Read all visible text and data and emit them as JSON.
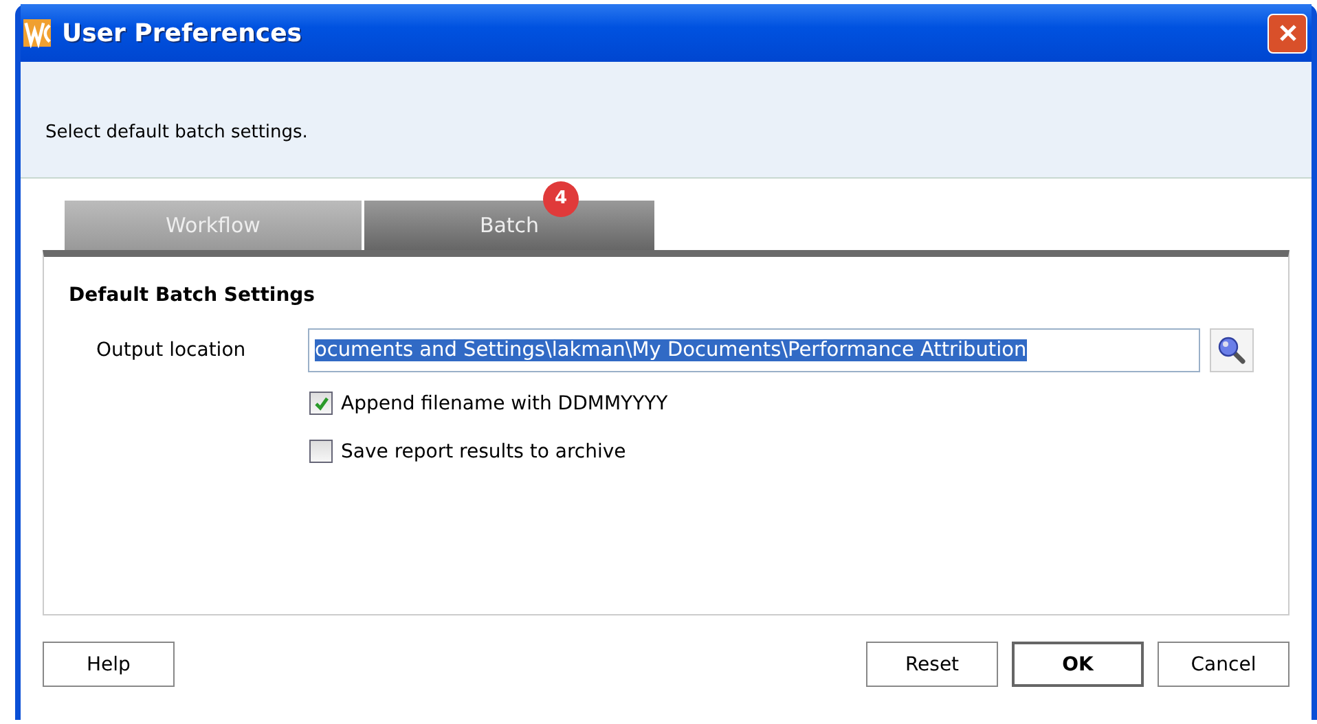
{
  "window": {
    "title": "User Preferences"
  },
  "header": {
    "instruction": "Select default batch settings."
  },
  "tabs": [
    {
      "label": "Workflow",
      "selected": false
    },
    {
      "label": "Batch",
      "selected": true,
      "badge": "4"
    }
  ],
  "section": {
    "title": "Default Batch Settings"
  },
  "output_location": {
    "label": "Output location",
    "value": "ocuments and Settings\\lakman\\My Documents\\Performance Attribution",
    "text_selected": true
  },
  "options": [
    {
      "label": "Append filename with DDMMYYYY",
      "checked": true
    },
    {
      "label": "Save report results to archive",
      "checked": false
    }
  ],
  "left_buttons": [
    {
      "label": "Help",
      "default": false
    }
  ],
  "right_buttons": [
    {
      "label": "Reset",
      "default": false
    },
    {
      "label": "OK",
      "default": true
    },
    {
      "label": "Cancel",
      "default": false
    }
  ]
}
